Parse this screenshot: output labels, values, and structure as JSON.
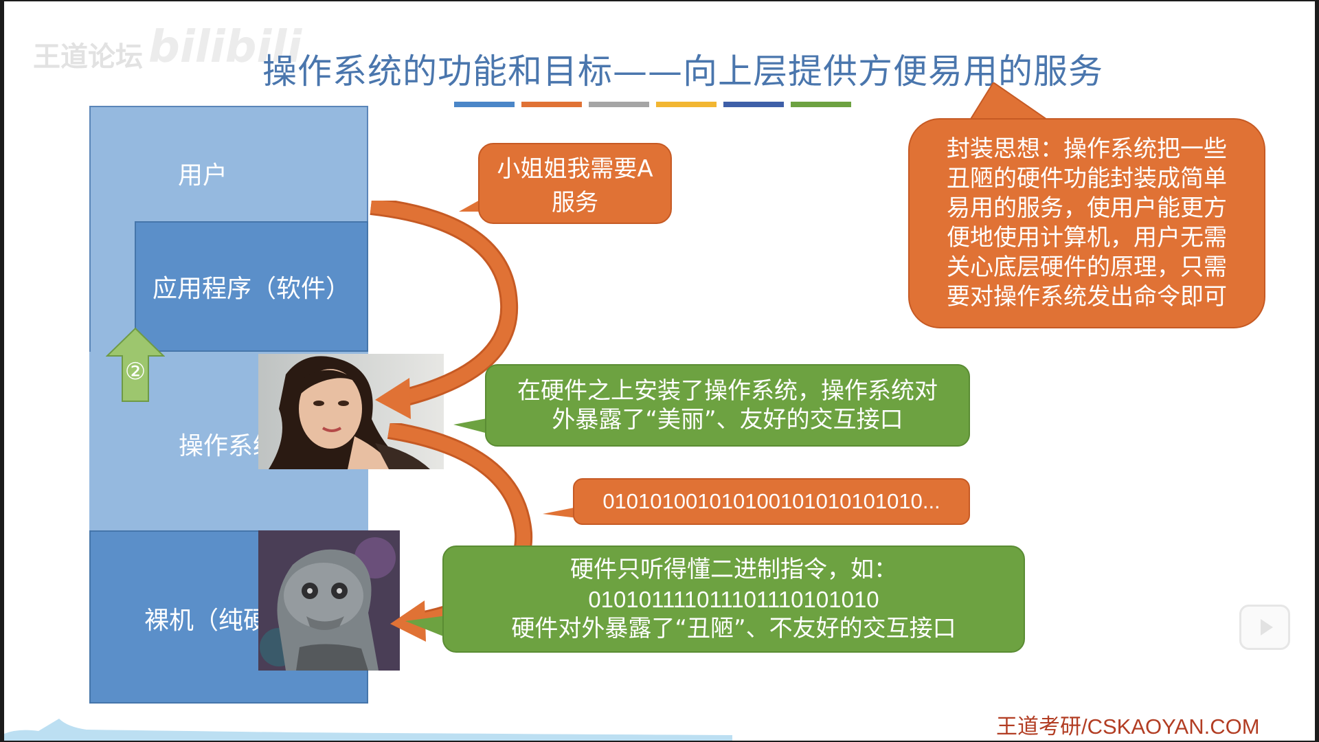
{
  "slide": {
    "title": "操作系统的功能和目标——向上层提供方便易用的服务",
    "watermark_left": "王道论坛",
    "watermark_right": "bilibili",
    "divider_colors": [
      "#4a86c8",
      "#e07235",
      "#a5a5a5",
      "#f2b632",
      "#3e5fa8",
      "#6da241"
    ]
  },
  "layers": {
    "user": "用户",
    "app": "应用程序（软件）",
    "os": "操作系统",
    "hardware": "裸机（纯硬件）"
  },
  "step_badge": "②",
  "bubbles": {
    "request": "小姐姐我需要A服务",
    "encapsulation": "封装思想：操作系统把一些丑陋的硬件功能封装成简单易用的服务，使用户能更方便地使用计算机，用户无需关心底层硬件的原理，只需要对操作系统发出命令即可",
    "os_interface": "在硬件之上安装了操作系统，操作系统对外暴露了“美丽”、友好的交互接口",
    "binary": "010101001010100101010101010...",
    "hw_line1": "硬件只听得懂二进制指令，如：",
    "hw_line2": "010101111011101110101010",
    "hw_line3": "硬件对外暴露了“丑陋”、不友好的交互接口"
  },
  "photos": {
    "beauty": "beauty-photo",
    "alien": "alien-photo"
  },
  "footer": "王道考研/CSKAOYAN.COM",
  "colors": {
    "title": "#4a76ad",
    "layer_light": "#95b9df",
    "layer_dark": "#5b8fc9",
    "orange": "#e07235",
    "green": "#6da241",
    "arrow_up": "#9dc66e"
  }
}
